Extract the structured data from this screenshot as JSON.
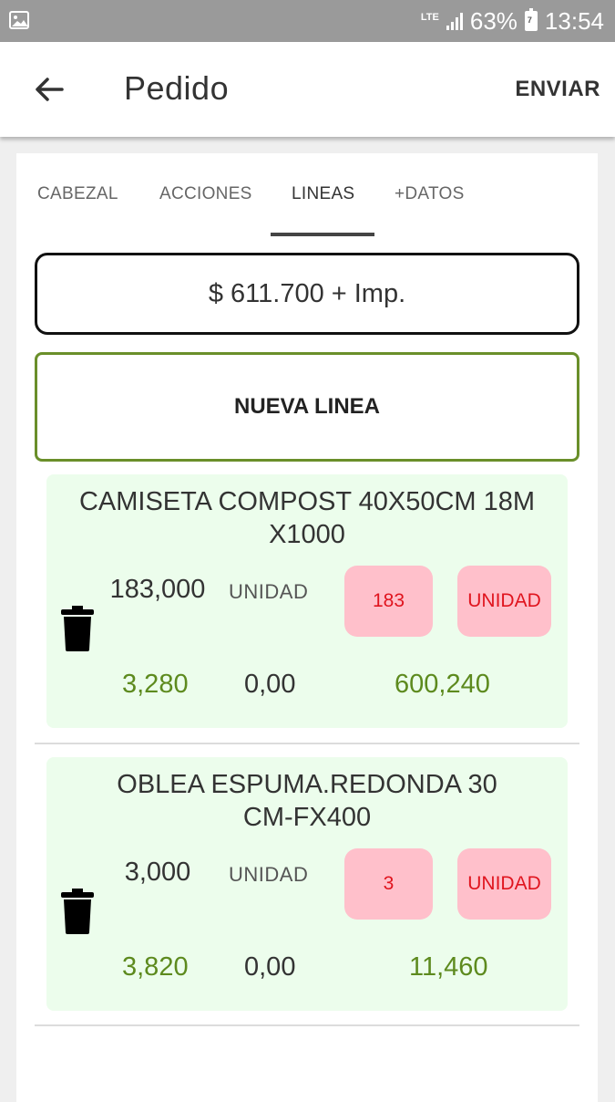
{
  "status_bar": {
    "network": "LTE",
    "battery": "63%",
    "battery_icon_label": "7",
    "time": "13:54"
  },
  "app_bar": {
    "title": "Pedido",
    "action": "ENVIAR"
  },
  "tabs": [
    {
      "label": "CABEZAL"
    },
    {
      "label": "ACCIONES"
    },
    {
      "label": "LINEAS",
      "active": true
    },
    {
      "label": "+DATOS"
    }
  ],
  "total": "$ 611.700 + Imp.",
  "new_line_button": "NUEVA LINEA",
  "lines": [
    {
      "title_line1": "CAMISETA COMPOST 40X50CM 18M",
      "title_line2": "X1000",
      "quantity": "183,000",
      "unit": "UNIDAD",
      "qty_box": "183",
      "unit_box": "UNIDAD",
      "price": "3,280",
      "discount": "0,00",
      "total": "600,240"
    },
    {
      "title_line1": "OBLEA ESPUMA.REDONDA 30",
      "title_line2": "CM-FX400",
      "quantity": "3,000",
      "unit": "UNIDAD",
      "qty_box": "3",
      "unit_box": "UNIDAD",
      "price": "3,820",
      "discount": "0,00",
      "total": "11,460"
    }
  ],
  "colors": {
    "accent_green": "#5d8a1e",
    "line_background": "#ecfdec",
    "pink_box": "#ffc0cb",
    "pink_text": "#e0141e",
    "status_bar": "#9a9a9a"
  }
}
